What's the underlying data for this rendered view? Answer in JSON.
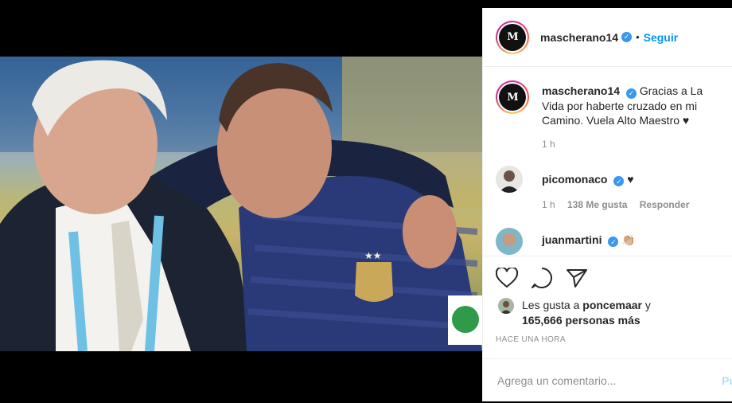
{
  "post": {
    "username": "mascherano14",
    "follow_label": "Seguir",
    "avatar_text": "M"
  },
  "comments": [
    {
      "username": "mascherano14",
      "text": "Gracias a La Vida por haberte cruzado en mi Camino. Vuela Alto Maestro",
      "time": "1 h"
    },
    {
      "username": "picomonaco",
      "time": "1 h",
      "likes": "138 Me gusta",
      "reply": "Responder"
    },
    {
      "username": "juanmartini",
      "text": "👏🏼"
    }
  ],
  "likes": {
    "prefix": "Les gusta a",
    "user": "poncemaar",
    "joiner": "y",
    "others": "165,666 personas más"
  },
  "posted_ago": "HACE UNA HORA",
  "comment_box": {
    "placeholder": "Agrega un comentario...",
    "post_label": "Pu"
  },
  "colors": {
    "link": "#0095f6",
    "verified": "#3897f0",
    "muted": "#8e8e8e"
  }
}
